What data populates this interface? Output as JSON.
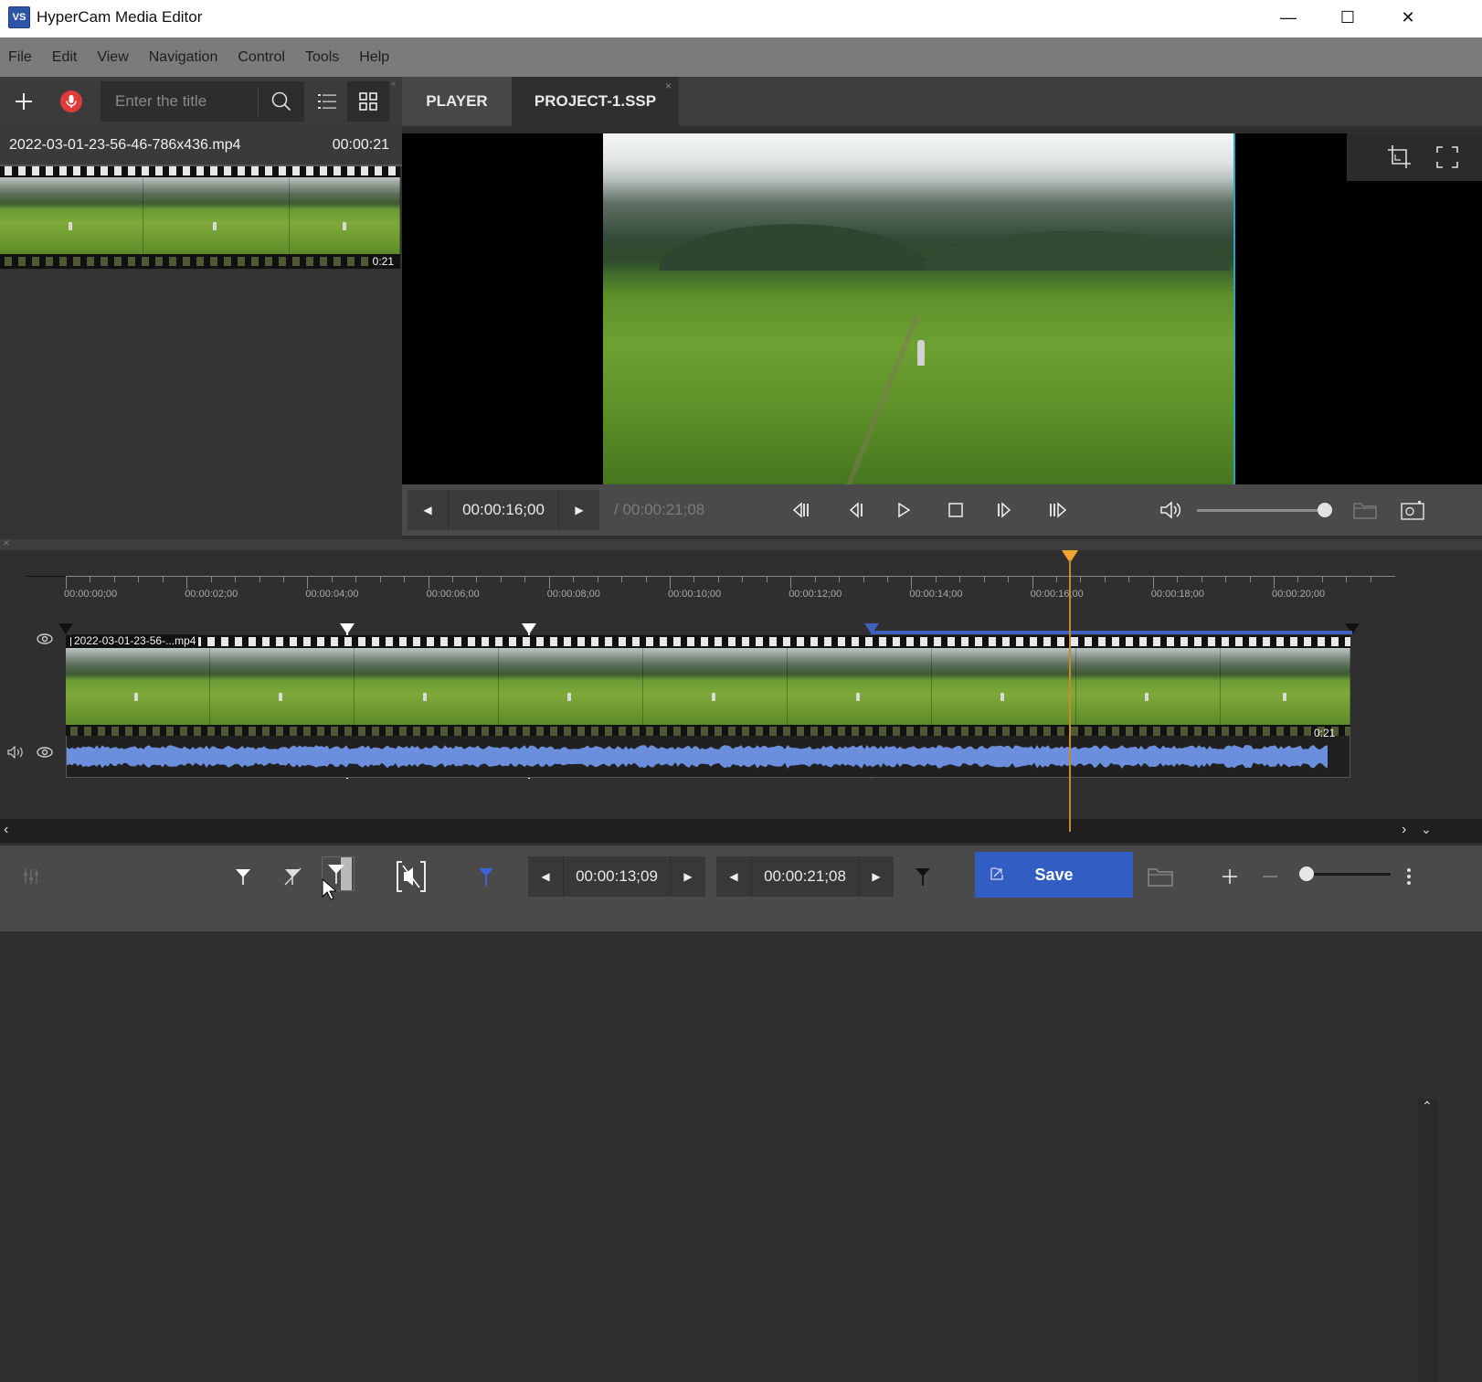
{
  "window": {
    "title": "HyperCam Media Editor",
    "logo_text": "VS",
    "controls": {
      "minimize": "—",
      "maximize": "☐",
      "close": "✕"
    }
  },
  "menu": [
    "File",
    "Edit",
    "View",
    "Navigation",
    "Control",
    "Tools",
    "Help"
  ],
  "library": {
    "search_placeholder": "Enter the title",
    "search_value": "",
    "media_items": [
      {
        "name": "2022-03-01-23-56-46-786x436.mp4",
        "duration": "00:00:21",
        "thumb_duration": "0:21"
      }
    ]
  },
  "tabs": [
    {
      "label": "PLAYER",
      "active": false
    },
    {
      "label": "PROJECT-1.SSP",
      "active": true,
      "close": "×"
    }
  ],
  "player": {
    "current_time": "00:00:16;00",
    "duration": "/ 00:00:21;08",
    "volume_percent": 100
  },
  "timeline": {
    "ruler_labels": [
      "00:00:00;00",
      "00:00:02;00",
      "00:00:04;00",
      "00:00:06;00",
      "00:00:08;00",
      "00:00:10;00",
      "00:00:12;00",
      "00:00:14;00",
      "00:00:16;00",
      "00:00:18;00",
      "00:00:20;00"
    ],
    "clip_label": "2022-03-01-23-56-...mp4",
    "clip_duration": "0:21",
    "playhead_time": "00:00:16;00",
    "accent_playhead": "#f6a531",
    "accent_selection": "#3e61c0"
  },
  "bottom_bar": {
    "selection_start": "00:00:13;09",
    "selection_end": "00:00:21;08",
    "save_label": "Save",
    "accent_save": "#325dc2",
    "zoom_percent": 0
  }
}
